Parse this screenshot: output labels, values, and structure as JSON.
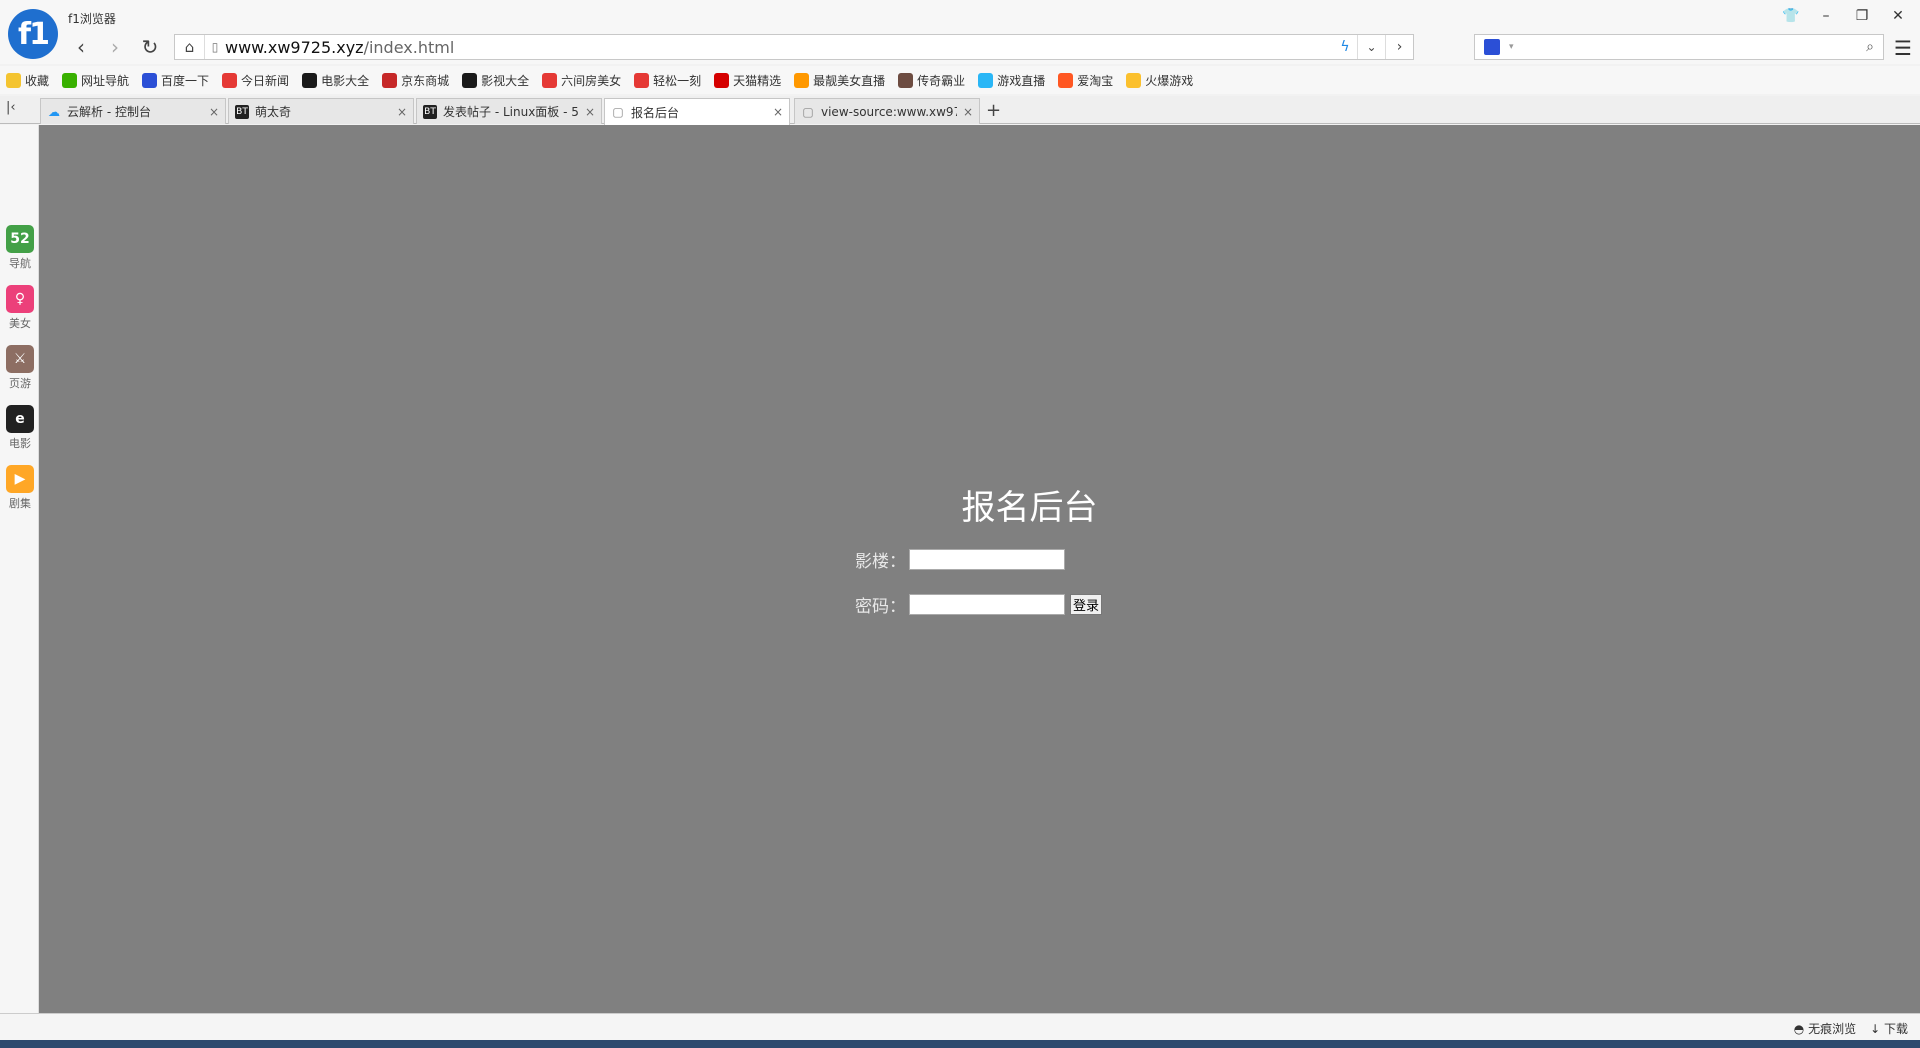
{
  "window": {
    "app_title": "f1浏览器",
    "logo_text": "f1",
    "controls": [
      "👕",
      "–",
      "❐",
      "✕"
    ]
  },
  "nav": {
    "back_icon": "‹",
    "forward_icon": "›",
    "refresh_icon": "↻",
    "home_icon": "⌂",
    "url_host": "www.xw9725.xyz",
    "url_path": "/index.html",
    "menu_icon": "☰"
  },
  "bookmarks": [
    {
      "label": "收藏",
      "color": "#f4c430"
    },
    {
      "label": "网址导航",
      "color": "#38b000"
    },
    {
      "label": "百度一下",
      "color": "#2b4fd6"
    },
    {
      "label": "今日新闻",
      "color": "#e53935"
    },
    {
      "label": "电影大全",
      "color": "#1a1a1a"
    },
    {
      "label": "京东商城",
      "color": "#c62828"
    },
    {
      "label": "影视大全",
      "color": "#1a1a1a"
    },
    {
      "label": "六间房美女",
      "color": "#e53935"
    },
    {
      "label": "轻松一刻",
      "color": "#e53935"
    },
    {
      "label": "天猫精选",
      "color": "#d50000"
    },
    {
      "label": "最靓美女直播",
      "color": "#ff9800"
    },
    {
      "label": "传奇霸业",
      "color": "#6d4c41"
    },
    {
      "label": "游戏直播",
      "color": "#29b6f6"
    },
    {
      "label": "爱淘宝",
      "color": "#ff5722"
    },
    {
      "label": "火爆游戏",
      "color": "#fbc02d"
    }
  ],
  "tabs": [
    {
      "label": "云解析 - 控制台",
      "icon": "☁",
      "icon_color": "#2196f3",
      "active": false
    },
    {
      "label": "萌太奇",
      "icon": "BT",
      "icon_color": "#222",
      "active": false
    },
    {
      "label": "发表帖子 - Linux面板 - 5",
      "icon": "BT",
      "icon_color": "#222",
      "active": false
    },
    {
      "label": "报名后台",
      "icon": "▢",
      "icon_color": "#888",
      "active": true
    },
    {
      "label": "view-source:www.xw97",
      "icon": "▢",
      "icon_color": "#888",
      "active": false
    }
  ],
  "new_tab_icon": "+",
  "tab_toggle_icon": "|‹",
  "sidebar": [
    {
      "label": "导航",
      "glyph": "52",
      "color": "#43a047"
    },
    {
      "label": "美女",
      "glyph": "♀",
      "color": "#ec407a"
    },
    {
      "label": "页游",
      "glyph": "⚔",
      "color": "#8d6e63"
    },
    {
      "label": "电影",
      "glyph": "e",
      "color": "#212121"
    },
    {
      "label": "剧集",
      "glyph": "▶",
      "color": "#ffa726"
    }
  ],
  "login": {
    "title": "报名后台",
    "field1_label": "影楼：",
    "field2_label": "密码：",
    "button_label": "登录"
  },
  "status": {
    "incognito": "无痕浏览",
    "download": "下载"
  }
}
